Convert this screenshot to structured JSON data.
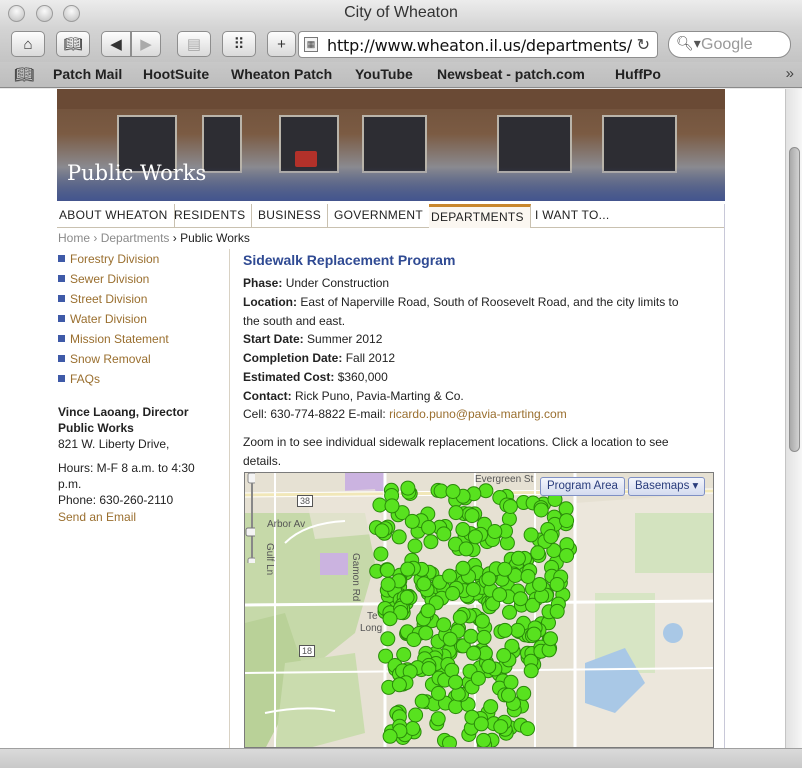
{
  "browser": {
    "title": "City of Wheaton",
    "url": "http://www.wheaton.il.us/departments/",
    "search_placeholder": "Google",
    "bookmarks": [
      "Patch Mail",
      "HootSuite",
      "Wheaton Patch",
      "YouTube",
      "Newsbeat - patch.com",
      "HuffPo"
    ]
  },
  "banner": {
    "title": "Public Works"
  },
  "nav": [
    "ABOUT WHEATON",
    "RESIDENTS",
    "BUSINESS",
    "GOVERNMENT",
    "DEPARTMENTS",
    "I WANT TO..."
  ],
  "nav_active": "DEPARTMENTS",
  "breadcrumb": {
    "home": "Home",
    "departments": "Departments",
    "current": "Public Works"
  },
  "sidebar": {
    "links": [
      "Forestry Division",
      "Sewer Division",
      "Street Division",
      "Water Division",
      "Mission Statement",
      "Snow Removal",
      "FAQs"
    ],
    "director_name": "Vince Laoang, Director",
    "department": "Public Works",
    "address": "821 W. Liberty Drive,",
    "hours_line1": "Hours: M-F 8 a.m. to 4:30",
    "hours_line2": "p.m.",
    "phone": "Phone: 630-260-2110",
    "email_link": "Send an Email"
  },
  "content": {
    "title": "Sidewalk Replacement Program",
    "phase_label": "Phase:",
    "phase": "Under Construction",
    "location_label": "Location:",
    "location_line1": "East of Naperville Road, South of Roosevelt Road, and the city limits to",
    "location_line2": "the south and east.",
    "start_label": "Start Date:",
    "start": "Summer 2012",
    "completion_label": "Completion Date:",
    "completion": "Fall 2012",
    "cost_label": "Estimated Cost:",
    "cost": "$360,000",
    "contact_label": "Contact:",
    "contact": "Rick Puno, Pavia-Marting & Co.",
    "cell": "Cell: 630-774-8822 E-mail:",
    "email": "ricardo.puno@pavia-marting.com",
    "zoom_line1": "Zoom in to see individual sidewalk replacement locations. Click a location to see",
    "zoom_line2": "details."
  },
  "map": {
    "program_area_btn": "Program Area",
    "basemaps_btn": "Basemaps",
    "street_labels": [
      "Evergreen St",
      "Arbor Av",
      "Gamon Rd",
      "Long",
      "Gulf Ln",
      "Te"
    ],
    "route_shields": [
      "38",
      "18"
    ],
    "colors": {
      "marker": "#58e21f",
      "marker_edge": "#2a8a0a",
      "water": "#a9c8e6",
      "park": "#c4d9a7",
      "land": "#e8e3d6",
      "zone": "#cbb3e0"
    }
  }
}
